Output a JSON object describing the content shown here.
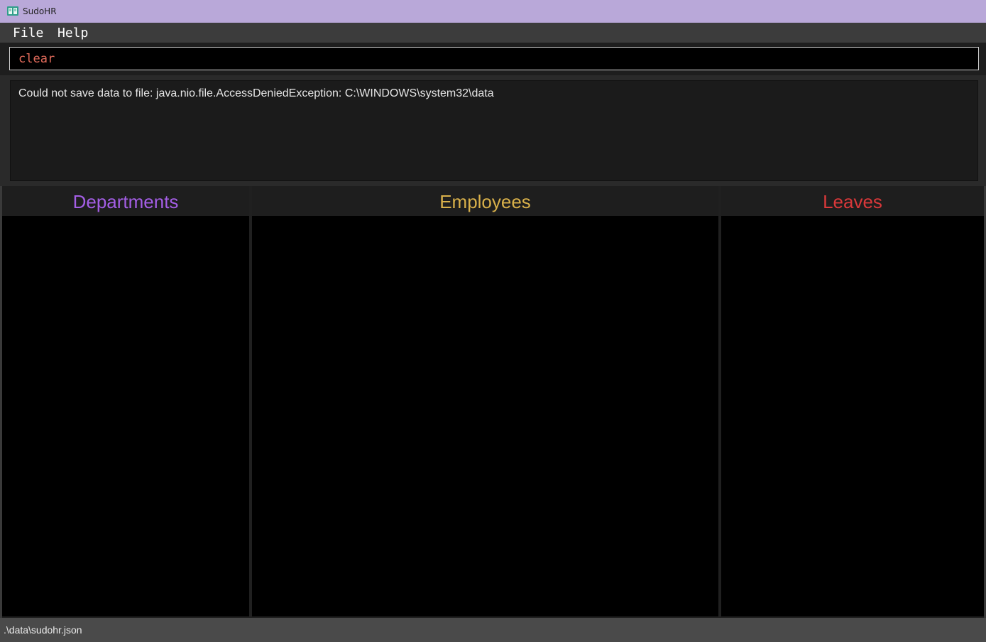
{
  "window": {
    "title": "SudoHR",
    "app_icon": "book-icon"
  },
  "menubar": {
    "items": [
      "File",
      "Help"
    ]
  },
  "command": {
    "value": "clear",
    "text_color": "#e06a5a"
  },
  "result": {
    "message": "Could not save data to file: java.nio.file.AccessDeniedException: C:\\WINDOWS\\system32\\data"
  },
  "panels": {
    "departments": {
      "title": "Departments",
      "color": "#a45ee5"
    },
    "employees": {
      "title": "Employees",
      "color": "#d8b04a"
    },
    "leaves": {
      "title": "Leaves",
      "color": "#d9383a"
    }
  },
  "status": {
    "path": ".\\data\\sudohr.json"
  },
  "colors": {
    "titlebar": "#b9a8d9",
    "background": "#000000"
  }
}
